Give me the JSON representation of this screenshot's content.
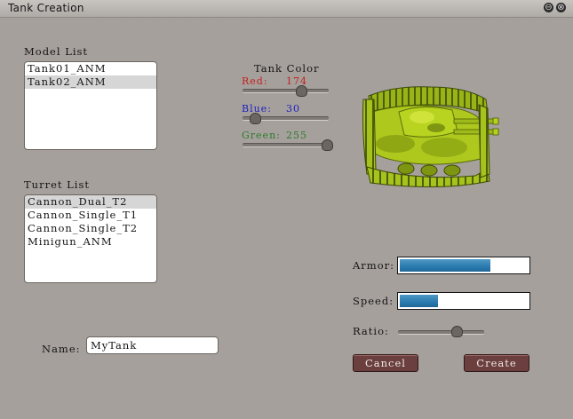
{
  "window": {
    "title": "Tank Creation",
    "minimize_glyph": "⊖",
    "close_glyph": "⊗"
  },
  "model_list": {
    "label": "Model List",
    "items": [
      "Tank01_ANM",
      "Tank02_ANM"
    ],
    "selected_index": 1
  },
  "turret_list": {
    "label": "Turret List",
    "items": [
      "Cannon_Dual_T2",
      "Cannon_Single_T1",
      "Cannon_Single_T2",
      "Minigun_ANM"
    ],
    "selected_index": 0
  },
  "tank_color": {
    "heading": "Tank Color",
    "red": {
      "label": "Red:",
      "value": "174",
      "color": "#c42020"
    },
    "blue": {
      "label": "Blue:",
      "value": "30",
      "color": "#1f1fc0"
    },
    "green": {
      "label": "Green:",
      "value": "255",
      "color": "#2d7a2d"
    },
    "tank_body_color": "#aec81e"
  },
  "stats": {
    "armor": {
      "label": "Armor:",
      "fill_fraction": 0.71
    },
    "speed": {
      "label": "Speed:",
      "fill_fraction": 0.3
    },
    "ratio": {
      "label": "Ratio:",
      "slider_fraction": 0.7
    }
  },
  "name": {
    "label": "Name:",
    "value": "MyTank"
  },
  "buttons": {
    "cancel": "Cancel",
    "create": "Create"
  }
}
